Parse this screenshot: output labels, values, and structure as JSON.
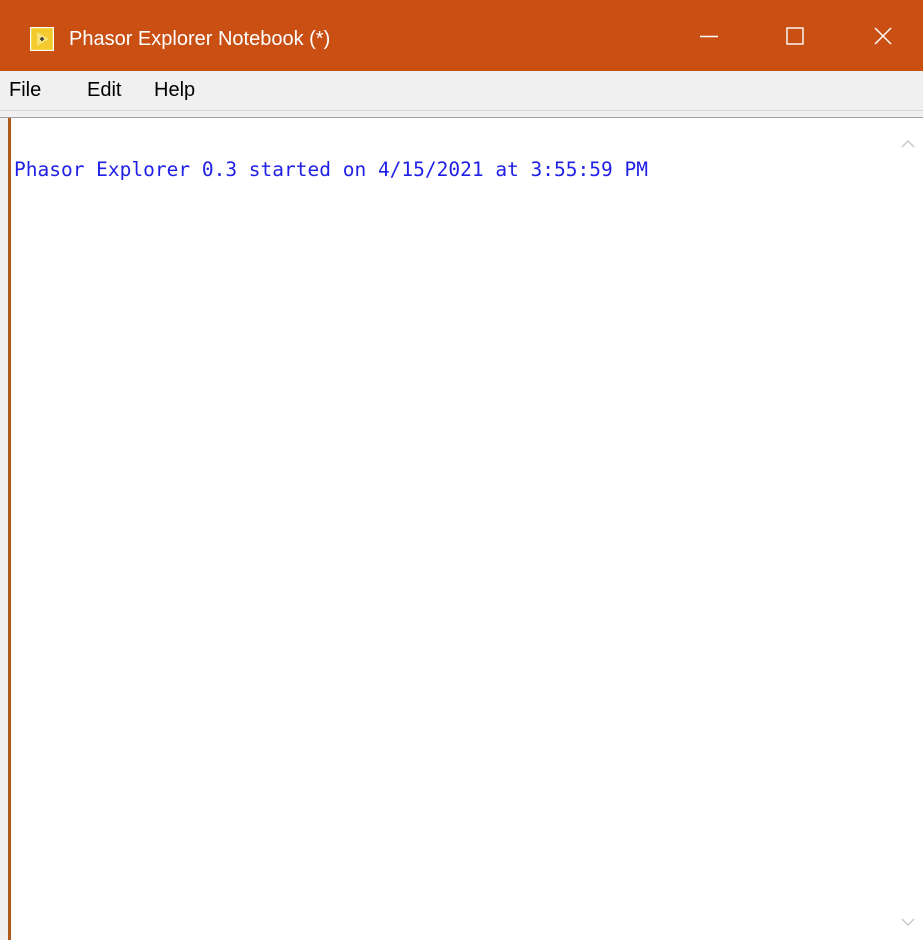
{
  "window": {
    "title": "Phasor Explorer Notebook (*)",
    "titlebar_color": "#c94f12",
    "icons": {
      "app": "labview-app-icon",
      "minimize": "minimize-icon",
      "maximize": "maximize-icon",
      "close": "close-icon"
    }
  },
  "menu": {
    "items": [
      {
        "label": "File"
      },
      {
        "label": "Edit"
      },
      {
        "label": "Help"
      }
    ]
  },
  "notebook": {
    "lines": [
      {
        "text": "Phasor Explorer 0.3 started on 4/15/2021 at 3:55:59 PM",
        "color": "#1f1fe6"
      }
    ],
    "scrollbar_icons": {
      "up": "chevron-up-icon",
      "down": "chevron-down-icon"
    }
  }
}
